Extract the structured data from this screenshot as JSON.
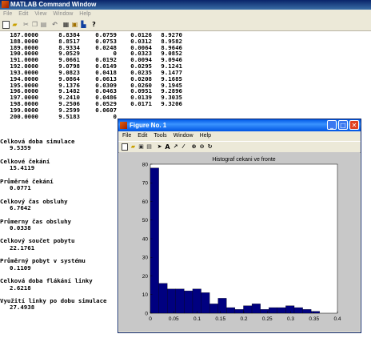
{
  "command_window": {
    "title": "MATLAB Command Window",
    "menu": [
      "File",
      "Edit",
      "View",
      "Window",
      "Help"
    ],
    "toolbar_icons": [
      "new-file-icon",
      "open-file-icon",
      "cut-icon",
      "copy-icon",
      "paste-icon",
      "undo-icon",
      "workspace-icon",
      "path-icon",
      "simulink-icon",
      "help-icon"
    ],
    "table_rows": [
      [
        "187.0000",
        "8.8384",
        "0.0759",
        "0.0126",
        "8.9270"
      ],
      [
        "188.0000",
        "8.8517",
        "0.0753",
        "0.0312",
        "8.9582"
      ],
      [
        "189.0000",
        "8.9334",
        "0.0248",
        "0.0064",
        "8.9646"
      ],
      [
        "190.0000",
        "9.0529",
        "0",
        "0.0323",
        "9.0852"
      ],
      [
        "191.0000",
        "9.0661",
        "0.0192",
        "0.0094",
        "9.0946"
      ],
      [
        "192.0000",
        "9.0798",
        "0.0149",
        "0.0295",
        "9.1241"
      ],
      [
        "193.0000",
        "9.0823",
        "0.0418",
        "0.0235",
        "9.1477"
      ],
      [
        "194.0000",
        "9.0864",
        "0.0613",
        "0.0208",
        "9.1685"
      ],
      [
        "195.0000",
        "9.1376",
        "0.0309",
        "0.0260",
        "9.1945"
      ],
      [
        "196.0000",
        "9.1482",
        "0.0463",
        "0.0951",
        "9.2896"
      ],
      [
        "197.0000",
        "9.2410",
        "0.0486",
        "0.0139",
        "9.3035"
      ],
      [
        "198.0000",
        "9.2506",
        "0.0529",
        "0.0171",
        "9.3206"
      ],
      [
        "199.0000",
        "9.2599",
        "0.0607",
        "",
        ""
      ],
      [
        "200.0000",
        "9.5183",
        "0",
        "",
        ""
      ]
    ],
    "stats": [
      {
        "label": "Celková doba simulace",
        "value": "9.5359"
      },
      {
        "label": "Celkové čekání",
        "value": "15.4119"
      },
      {
        "label": "Průměrné čekání",
        "value": "0.0771"
      },
      {
        "label": "Celkový čas obsluhy",
        "value": "6.7642"
      },
      {
        "label": "Průmerny čas obsluhy",
        "value": "0.0338"
      },
      {
        "label": "Celkový součet pobytu",
        "value": "22.1761"
      },
      {
        "label": "Průměrný pobyt v systému",
        "value": "0.1109"
      },
      {
        "label": "Celková doba flákání linky",
        "value": "2.6218"
      },
      {
        "label": "Využití linky po dobu simulace",
        "value": "27.4938"
      }
    ]
  },
  "figure_window": {
    "title": "Figure No. 1",
    "menu": [
      "File",
      "Edit",
      "Tools",
      "Window",
      "Help"
    ],
    "buttons": {
      "minimize": "_",
      "maximize": "□",
      "close": "✕"
    },
    "toolbar_icons": [
      "new-figure-icon",
      "open-icon",
      "save-icon",
      "print-icon",
      "arrow-icon",
      "text-icon",
      "arrow-tool-icon",
      "line-icon",
      "zoom-in-icon",
      "zoom-out-icon",
      "rotate-icon"
    ]
  },
  "chart_data": {
    "type": "bar",
    "title": "Histograf cekani ve fronte",
    "xlabel": "",
    "ylabel": "",
    "xlim": [
      0,
      0.4
    ],
    "ylim": [
      0,
      80
    ],
    "xticks": [
      "0",
      "0.05",
      "0.1",
      "0.15",
      "0.2",
      "0.25",
      "0.3",
      "0.35",
      "0.4"
    ],
    "yticks": [
      "0",
      "10",
      "20",
      "30",
      "40",
      "50",
      "60",
      "70",
      "80"
    ],
    "bin_edges": [
      0,
      0.0181,
      0.0362,
      0.0543,
      0.0724,
      0.0905,
      0.1086,
      0.1267,
      0.1448,
      0.1629,
      0.181,
      0.1991,
      0.2172,
      0.2353,
      0.2534,
      0.2715,
      0.2896,
      0.3077,
      0.3258,
      0.3439,
      0.362
    ],
    "values": [
      78,
      16,
      13,
      13,
      12,
      13,
      11,
      5,
      8,
      3,
      2,
      4,
      5,
      2,
      3,
      3,
      4,
      3,
      2,
      1
    ],
    "bar_color": "#000080",
    "background": "#ffffff",
    "grid": false
  }
}
